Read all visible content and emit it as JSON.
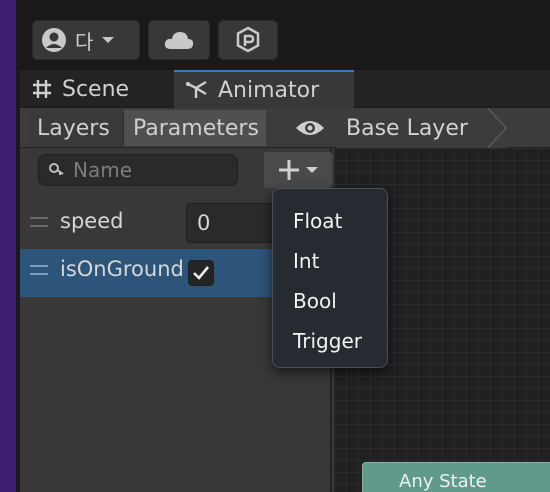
{
  "topbar": {
    "account_label": "다",
    "cloud_icon": "cloud-icon",
    "collab_icon": "collab-icon"
  },
  "tabs": [
    {
      "label": "Scene",
      "icon": "grid-icon"
    },
    {
      "label": "Animator",
      "icon": "animator-icon",
      "active": true
    }
  ],
  "toolbar": {
    "layers_label": "Layers",
    "parameters_label": "Parameters",
    "breadcrumb": "Base Layer"
  },
  "search": {
    "placeholder": "Name",
    "value": ""
  },
  "parameters": [
    {
      "name": "speed",
      "value": "0",
      "type": "float"
    },
    {
      "name": "isOnGround",
      "checked": true,
      "type": "bool",
      "selected": true
    }
  ],
  "add_menu": {
    "items": [
      "Float",
      "Int",
      "Bool",
      "Trigger"
    ]
  },
  "graph": {
    "any_state_label": "Any State",
    "any_state_color": "#5f9a8c"
  },
  "colors": {
    "accent": "#3a79bb",
    "selection": "#2d5479",
    "sidebar": "#3f1d70"
  }
}
